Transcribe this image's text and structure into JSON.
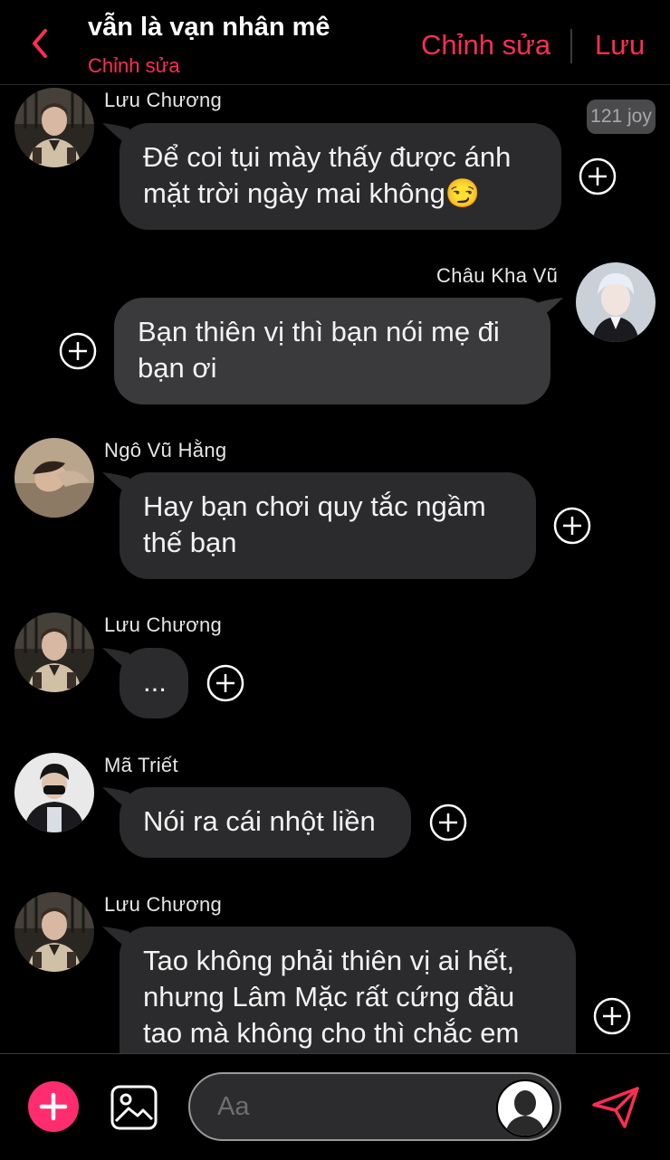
{
  "header": {
    "title": "vẫn là vạn nhân mê",
    "subtitle": "Chỉnh sửa",
    "edit_label": "Chỉnh sửa",
    "save_label": "Lưu",
    "accent": "#ff2d55"
  },
  "badge": {
    "text": "121 joy"
  },
  "messages": [
    {
      "sender": "Lưu Chương",
      "lines": [
        "Để coi tụi mày thấy được ánh",
        "mặt trời ngày mai không😏"
      ]
    },
    {
      "sender": "Châu Kha Vũ",
      "lines": [
        "Bạn thiên vị thì bạn nói mẹ đi",
        "bạn ơi"
      ]
    },
    {
      "sender": "Ngô Vũ Hằng",
      "lines": [
        "Hay bạn chơi quy tắc ngầm",
        "thế bạn"
      ]
    },
    {
      "sender": "Lưu Chương",
      "lines": [
        "..."
      ]
    },
    {
      "sender": "Mã Triết",
      "lines": [
        "Nói ra cái nhột liền"
      ]
    },
    {
      "sender": "Lưu Chương",
      "lines": [
        "Tao không phải thiên vị ai hết,",
        "nhưng Lâm Mặc rất cứng đầu",
        "tao mà không cho thì chắc em"
      ]
    }
  ],
  "composer": {
    "placeholder": "Aa"
  }
}
